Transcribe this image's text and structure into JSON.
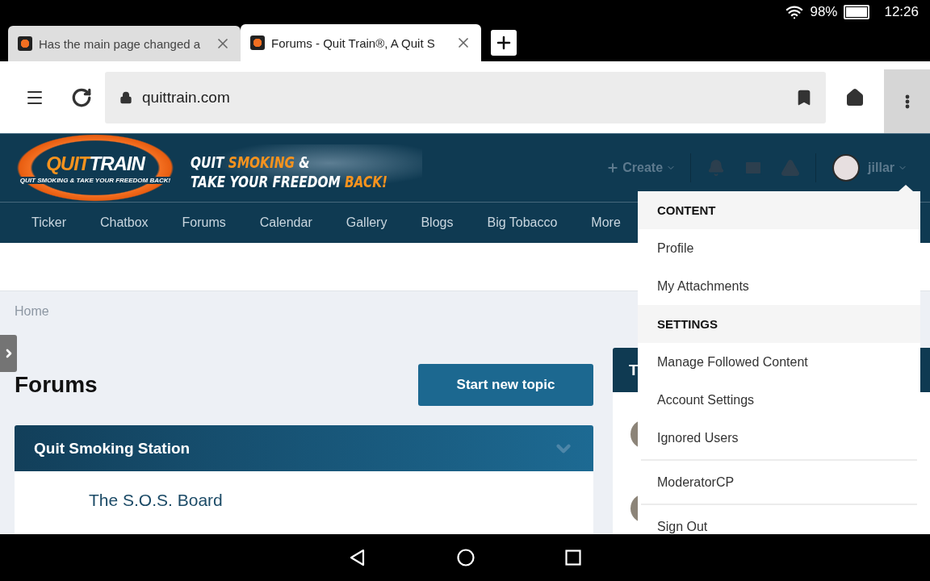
{
  "status_bar": {
    "battery": "98%",
    "time": "12:26"
  },
  "browser_tabs": [
    {
      "title": "Has the main page changed a",
      "selected": false
    },
    {
      "title": "Forums - Quit Train®, A Quit S",
      "selected": true
    }
  ],
  "address_bar": {
    "url": "quittrain.com"
  },
  "site_header": {
    "logo": {
      "segments": [
        {
          "text": "QUIT",
          "accent": true
        },
        {
          "text": "TRAIN",
          "accent": false
        }
      ],
      "tagline": "QUIT SMOKING & TAKE YOUR FREEDOM BACK!"
    },
    "banner": [
      [
        {
          "text": "QUIT ",
          "accent": false
        },
        {
          "text": "SMOKING",
          "accent": true
        },
        {
          "text": " &",
          "accent": false
        }
      ],
      [
        {
          "text": "TAKE YOUR FREEDOM ",
          "accent": false
        },
        {
          "text": "BACK!",
          "accent": true
        }
      ]
    ],
    "create": "Create",
    "username": "jillar"
  },
  "nav": [
    {
      "label": "Ticker"
    },
    {
      "label": "Chatbox"
    },
    {
      "label": "Forums"
    },
    {
      "label": "Calendar"
    },
    {
      "label": "Gallery"
    },
    {
      "label": "Blogs"
    },
    {
      "label": "Big Tobacco"
    },
    {
      "label": "More"
    }
  ],
  "breadcrumb": [
    "Home"
  ],
  "page_title": "Forums",
  "primary_button": "Start new topic",
  "categories": [
    {
      "title": "Quit Smoking Station",
      "expanded": true,
      "forums": [
        "The S.O.S. Board"
      ]
    }
  ],
  "side_panel": {
    "title": "T"
  },
  "user_menu": [
    {
      "kind": "header",
      "label": "CONTENT"
    },
    {
      "kind": "item",
      "label": "Profile"
    },
    {
      "kind": "item",
      "label": "My Attachments"
    },
    {
      "kind": "header",
      "label": "SETTINGS"
    },
    {
      "kind": "item",
      "label": "Manage Followed Content"
    },
    {
      "kind": "item",
      "label": "Account Settings"
    },
    {
      "kind": "item",
      "label": "Ignored Users"
    },
    {
      "kind": "divider"
    },
    {
      "kind": "item",
      "label": "ModeratorCP"
    },
    {
      "kind": "divider"
    },
    {
      "kind": "item",
      "label": "Sign Out"
    }
  ]
}
